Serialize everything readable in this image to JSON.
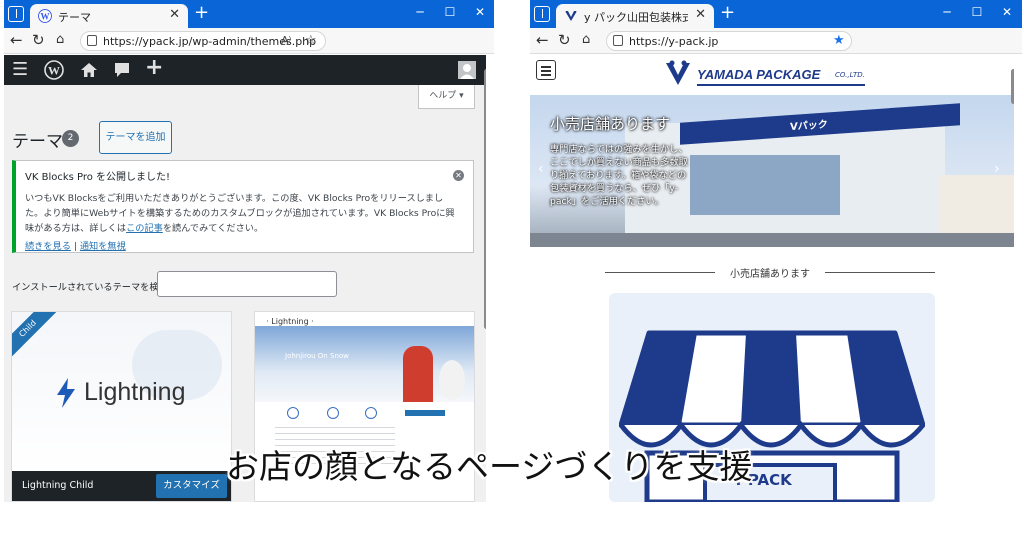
{
  "left_window": {
    "tab_title": "テーマ",
    "tab_close": "✕",
    "new_tab": "+",
    "controls": {
      "minimize": "─",
      "maximize": "☐",
      "close": "✕"
    },
    "url": "https://ypack.jp/wp-admin/themes.php",
    "read_aloud": "A⁾",
    "favorite": "☆",
    "help": "ヘルプ ▾",
    "page_title": "テーマ",
    "theme_count": "2",
    "add_theme": "テーマを追加",
    "notice": {
      "heading": "VK Blocks Pro を公開しました!",
      "body_before_link": "いつもVK Blocksをご利用いただきありがとうございます。この度、VK Blocks Proをリリースしました。より簡単にWebサイトを構築するためのカスタムブロックが追加されています。VK Blocks Proに興味がある方は、詳しくは",
      "link": "この記事",
      "body_after_link": "を読んでみてください。",
      "read_more": "続きを見る",
      "separator": " | ",
      "disable": "通知を無視"
    },
    "search_label": "インストールされているテーマを検索",
    "themes": [
      {
        "name": "Lightning Child",
        "badge": "Child",
        "logo_text": "Lightning",
        "action": "カスタマイズ"
      },
      {
        "name": "Lightning",
        "preview_title": "· Lightning ·",
        "preview_hero": "Johnjirou On Snow"
      }
    ]
  },
  "right_window": {
    "tab_title": "y パック山田包装株式会社",
    "tab_close": "✕",
    "new_tab": "+",
    "controls": {
      "minimize": "─",
      "maximize": "☐",
      "close": "✕"
    },
    "url": "https://y-pack.jp",
    "favorite": "★",
    "logo_text": "YAMADA PACKAGE",
    "logo_suffix": "CO.,LTD.",
    "hero": {
      "heading": "小売店舗あります",
      "body": "専門店ならではの強みを生かし、ここでしか買えない商品も多数取り揃えております。箱や袋などの包装資材を買うなら、ぜひ「y-pack」をご活用ください。",
      "sign": "Vパック"
    },
    "section_heading": "小売店舗あります",
    "awning_sign": "Y-PACK"
  },
  "caption": "お店の顔となるページづくりを支援",
  "colors": {
    "titlebar": "#0a66d6",
    "wp_adminbar": "#1d2327",
    "wp_blue": "#2271b1",
    "brand_navy": "#1e3a8a"
  }
}
